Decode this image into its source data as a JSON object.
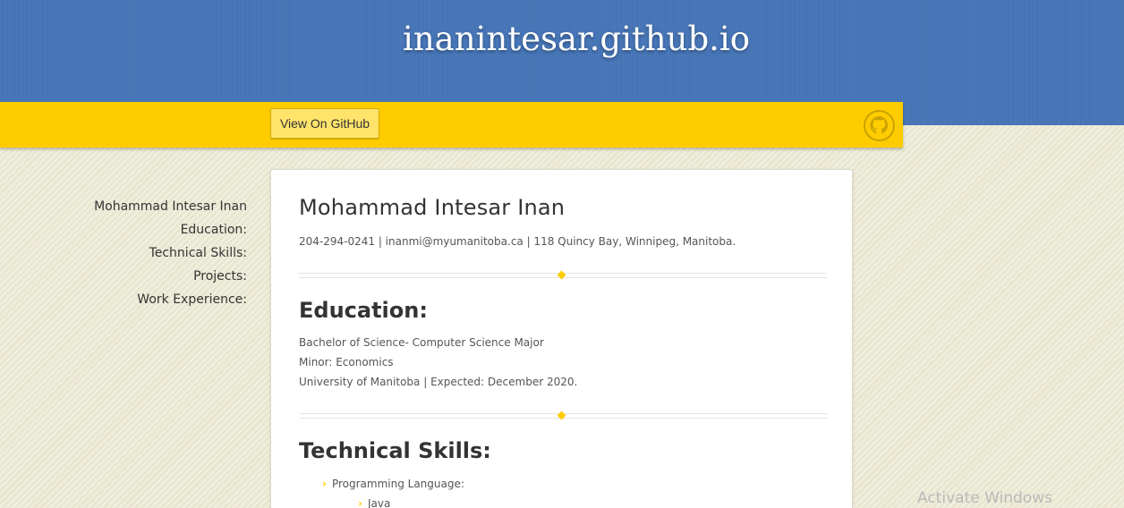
{
  "header": {
    "title": "inanintesar.github.io"
  },
  "ribbon": {
    "button_label": "View On GitHub",
    "octocat_icon": "github-octocat-icon"
  },
  "sidebar": {
    "items": [
      {
        "label": "Mohammad Intesar Inan"
      },
      {
        "label": "Education:"
      },
      {
        "label": "Technical Skills:"
      },
      {
        "label": "Projects:"
      },
      {
        "label": "Work Experience:"
      }
    ]
  },
  "content": {
    "name": "Mohammad Intesar Inan",
    "contact": "204-294-0241 | inanmi@myumanitoba.ca | 118 Quincy Bay, Winnipeg, Manitoba.",
    "education": {
      "heading": "Education:",
      "lines": [
        "Bachelor of Science- Computer Science Major",
        "Minor: Economics",
        "University of Manitoba | Expected: December 2020."
      ]
    },
    "skills": {
      "heading": "Technical Skills:",
      "items": [
        {
          "label": "Programming Language:"
        },
        {
          "label": "Java"
        }
      ]
    }
  },
  "overlay": {
    "watermark": "Activate Windows"
  },
  "colors": {
    "header_blue": "#4574b6",
    "ribbon_yellow": "#ffcc00",
    "page_background": "#e9e6d0"
  }
}
